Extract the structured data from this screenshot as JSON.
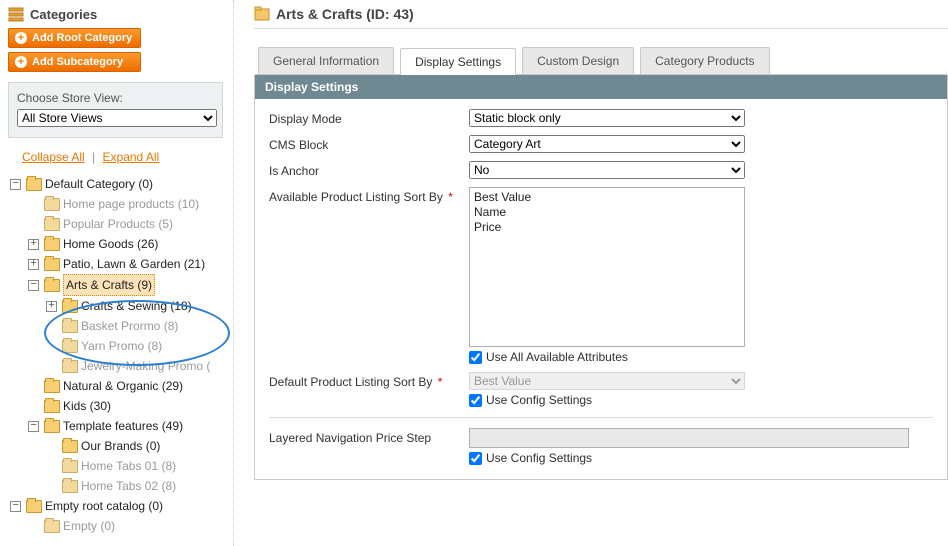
{
  "sidebar": {
    "heading": "Categories",
    "addRootBtn": "Add Root Category",
    "addSubBtn": "Add Subcategory",
    "storeViewLabel": "Choose Store View:",
    "storeViewValue": "All Store Views",
    "collapseAll": "Collapse All",
    "expandAll": "Expand All"
  },
  "tree": {
    "root": "Default Category (0)",
    "homePageProducts": "Home page products (10)",
    "popularProducts": "Popular Products (5)",
    "homeGoods": "Home Goods (26)",
    "patio": "Patio, Lawn & Garden (21)",
    "artsCrafts": "Arts & Crafts (9)",
    "craftsSewing": "Crafts & Sewing (18)",
    "basketPromo": "Basket Prormo (8)",
    "yarnPromo": "Yarn Promo (8)",
    "jewelryPromo": "Jewelry-Making Promo (",
    "naturalOrganic": "Natural & Organic (29)",
    "kids": "Kids (30)",
    "templateFeatures": "Template features (49)",
    "ourBrands": "Our Brands (0)",
    "homeTabs01": "Home Tabs 01 (8)",
    "homeTabs02": "Home Tabs 02 (8)",
    "emptyRoot": "Empty root catalog (0)",
    "empty": "Empty (0)"
  },
  "main": {
    "title": "Arts & Crafts (ID: 43)",
    "tabs": {
      "general": "General Information",
      "display": "Display Settings",
      "design": "Custom Design",
      "products": "Category Products"
    },
    "panelHeading": "Display Settings",
    "labels": {
      "displayMode": "Display Mode",
      "cmsBlock": "CMS Block",
      "isAnchor": "Is Anchor",
      "availSort": "Available Product Listing Sort By",
      "useAllAttr": "Use All Available Attributes",
      "defaultSort": "Default Product Listing Sort By",
      "useConfig": "Use Config Settings",
      "layeredNav": "Layered Navigation Price Step"
    },
    "values": {
      "displayMode": "Static block only",
      "cmsBlock": "Category Art",
      "isAnchor": "No",
      "sortOptions": [
        "Best Value",
        "Name",
        "Price"
      ],
      "defaultSort": "Best Value"
    }
  }
}
